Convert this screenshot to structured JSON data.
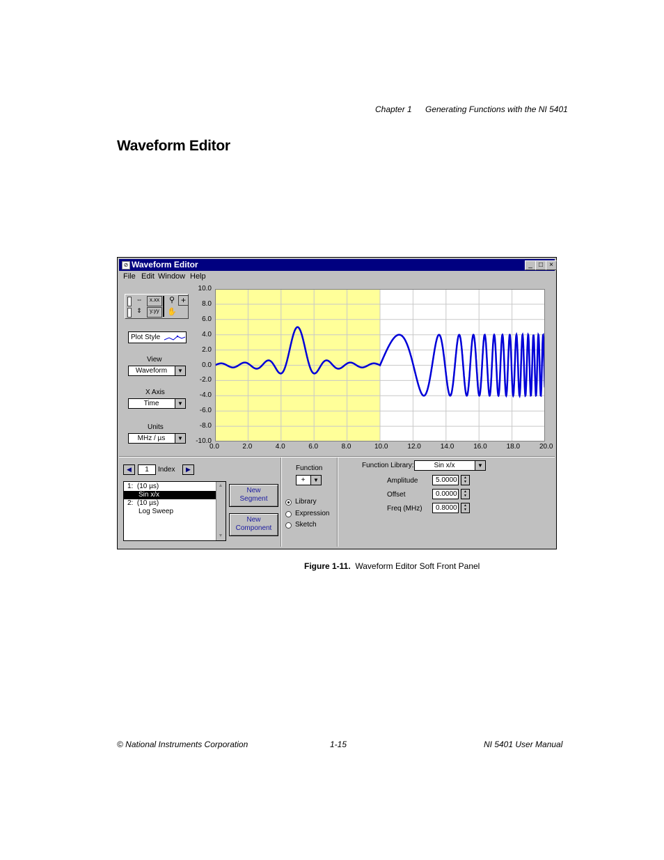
{
  "page_header": {
    "chapter": "Chapter 1",
    "chapter_title": "Generating Functions with the NI 5401"
  },
  "section_title": "Waveform Editor",
  "window": {
    "title": "Waveform Editor",
    "menu": [
      "File",
      "Edit",
      "Window",
      "Help"
    ],
    "buttons": {
      "minimize": "_",
      "maximize": "□",
      "close": "×"
    }
  },
  "left_panel": {
    "plot_style_label": "Plot Style",
    "view": {
      "label": "View",
      "value": "Waveform"
    },
    "x_axis": {
      "label": "X Axis",
      "value": "Time"
    },
    "units": {
      "label": "Units",
      "value": "MHz / µs"
    },
    "tools": [
      "x.xx",
      "y.yy"
    ]
  },
  "plot": {
    "y_ticks": [
      "10.0",
      "8.0",
      "6.0",
      "4.0",
      "2.0",
      "0.0",
      "-2.0",
      "-4.0",
      "-6.0",
      "-8.0",
      "-10.0"
    ],
    "x_ticks": [
      "0.0",
      "2.0",
      "4.0",
      "6.0",
      "8.0",
      "10.0",
      "12.0",
      "14.0",
      "16.0",
      "18.0",
      "20.0"
    ],
    "xlim": [
      0,
      20
    ],
    "ylim": [
      -10,
      10
    ],
    "highlight_range": [
      0,
      10
    ],
    "colors": {
      "highlight": "#ffff99",
      "trace": "#0000d8",
      "grid": "#c8c8c8",
      "plot_bg": "#ffffff"
    }
  },
  "segment_panel": {
    "index_value": "1",
    "index_label": "Index",
    "segments": [
      {
        "text": "1:  (10 µs)",
        "indent": false,
        "selected": false
      },
      {
        "text": "Sin x/x",
        "indent": true,
        "selected": true
      },
      {
        "text": "2:  (10 µs)",
        "indent": false,
        "selected": false
      },
      {
        "text": "Log Sweep",
        "indent": true,
        "selected": false
      }
    ],
    "new_segment": [
      "New",
      "Segment"
    ],
    "new_component": [
      "New",
      "Component"
    ]
  },
  "function_panel": {
    "label": "Function",
    "operator": "+",
    "options": [
      "Library",
      "Expression",
      "Sketch"
    ],
    "selected_option": "Library"
  },
  "library_panel": {
    "library_label": "Function Library:",
    "library_value": "Sin x/x",
    "amplitude": {
      "label": "Amplitude",
      "value": "5.0000"
    },
    "offset": {
      "label": "Offset",
      "value": "0.0000"
    },
    "freq": {
      "label": "Freq (MHz)",
      "value": "0.8000"
    }
  },
  "caption": {
    "figure": "Figure 1-11.",
    "text": "Waveform Editor Soft Front Panel"
  },
  "footer": {
    "left": "© National Instruments Corporation",
    "center": "1-15",
    "right": "NI 5401 User Manual"
  }
}
